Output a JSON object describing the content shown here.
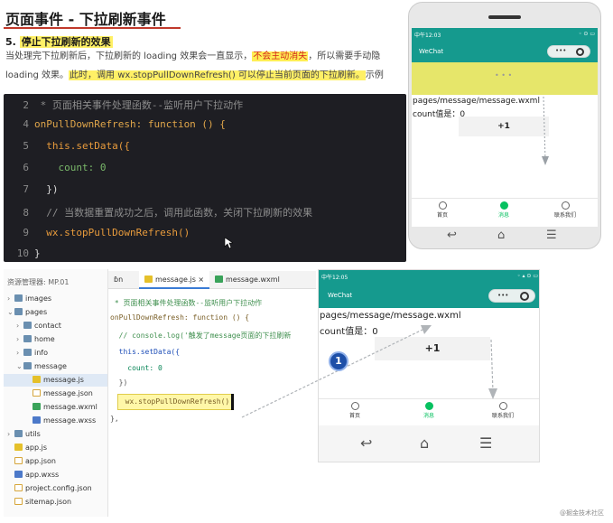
{
  "slide": {
    "title": "页面事件 - 下拉刷新事件",
    "section_num": "5.",
    "section_title": "停止下拉刷新的效果",
    "para_line1_a": "当处理完下拉刷新后，下拉刷新的 loading 效果会一直显示，",
    "para_line1_hl": "不会主动消失",
    "para_line1_b": "，所以需要手动隐",
    "para_line2_a": "loading 效果。",
    "para_line2_hl": "此时，调用 wx.stopPullDownRefresh() 可以停止当前页面的下拉刷新。",
    "para_line2_b": "示例"
  },
  "code_top": [
    {
      "num": "2",
      "text": " * 页面相关事件处理函数--监听用户下拉动作"
    },
    {
      "num": "4",
      "text": "onPullDownRefresh: function () {"
    },
    {
      "num": "5",
      "text": "  this.setData({"
    },
    {
      "num": "6",
      "text": "    count: 0"
    },
    {
      "num": "7",
      "text": "  })"
    },
    {
      "num": "8",
      "text": "  // 当数据重置成功之后，调用此函数，关闭下拉刷新的效果"
    },
    {
      "num": "9",
      "text": "  wx.stopPullDownRefresh()"
    },
    {
      "num": "10",
      "text": "}"
    }
  ],
  "phone1": {
    "status_left": "中午12:03",
    "status_right": "◦ ⊙ ▭",
    "nav_title": "WeChat",
    "capsule_dots": "•••",
    "loading_dots": "• • •",
    "path": "pages/message/message.wxml",
    "count_label": "count值是：0",
    "button": "+1",
    "tabs": [
      "首页",
      "消息",
      "联系我们"
    ],
    "sys_back": "↩",
    "sys_home": "⌂",
    "sys_menu": "☰"
  },
  "ide": {
    "project_label": "资源管理器: MP.01",
    "tabs": [
      "ɓn",
      "message.js ×",
      "message.wxml"
    ],
    "tree": [
      {
        "label": "images",
        "type": "folder",
        "indent": 1,
        "arrow": "›"
      },
      {
        "label": "pages",
        "type": "folder",
        "indent": 1,
        "arrow": "⌄"
      },
      {
        "label": "contact",
        "type": "folder",
        "indent": 2,
        "arrow": "›"
      },
      {
        "label": "home",
        "type": "folder",
        "indent": 2,
        "arrow": "›"
      },
      {
        "label": "info",
        "type": "folder",
        "indent": 2,
        "arrow": "›"
      },
      {
        "label": "message",
        "type": "folder",
        "indent": 2,
        "arrow": "⌄"
      },
      {
        "label": "message.js",
        "type": "js",
        "indent": 3,
        "arrow": ""
      },
      {
        "label": "message.json",
        "type": "json",
        "indent": 3,
        "arrow": ""
      },
      {
        "label": "message.wxml",
        "type": "wxml",
        "indent": 3,
        "arrow": ""
      },
      {
        "label": "message.wxss",
        "type": "wxss",
        "indent": 3,
        "arrow": ""
      },
      {
        "label": "utils",
        "type": "folder",
        "indent": 1,
        "arrow": "›"
      },
      {
        "label": "app.js",
        "type": "js",
        "indent": 1,
        "arrow": ""
      },
      {
        "label": "app.json",
        "type": "json",
        "indent": 1,
        "arrow": ""
      },
      {
        "label": "app.wxss",
        "type": "wxss",
        "indent": 1,
        "arrow": ""
      },
      {
        "label": "project.config.json",
        "type": "json",
        "indent": 1,
        "arrow": ""
      },
      {
        "label": "sitemap.json",
        "type": "json",
        "indent": 1,
        "arrow": ""
      }
    ],
    "code": [
      " * 页面相关事件处理函数--监听用户下拉动作",
      "onPullDownRefresh: function () {",
      "  // console.log('触发了message页面的下拉刷新",
      "  this.setData({",
      "    count: 0",
      "  })",
      "  wx.stopPullDownRefresh()",
      "},"
    ]
  },
  "phone2": {
    "status_left": "中午12:05",
    "status_right": "◦ ▴ ⊙ ▭",
    "nav_title": "WeChat",
    "capsule_dots": "•••",
    "path": "pages/message/message.wxml",
    "count_label": "count值是：0",
    "button": "+1",
    "tabs": [
      "首页",
      "消息",
      "联系我们"
    ],
    "sys_back": "↩",
    "sys_home": "⌂",
    "sys_menu": "☰"
  },
  "step_badge": "1",
  "watermark": "@掘金技术社区",
  "colors": {
    "wechat_teal": "#159a8e",
    "wechat_green": "#07c160",
    "highlight_yellow": "#fff066",
    "refresh_yellow": "#e6e66a",
    "alert_red": "#d4281c",
    "code_bg": "#1e1e23",
    "badge_blue": "#1d4fa8"
  }
}
